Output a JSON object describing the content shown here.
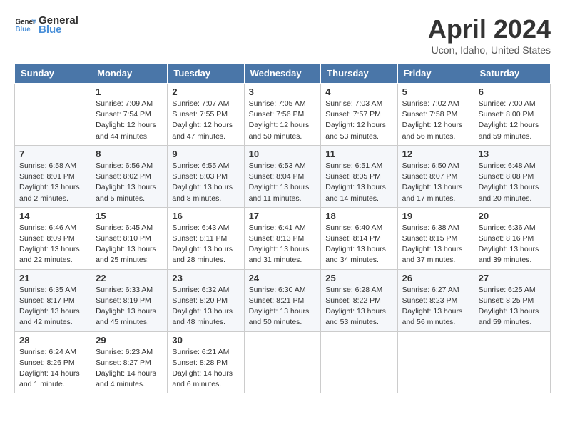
{
  "header": {
    "logo_general": "General",
    "logo_blue": "Blue",
    "month": "April 2024",
    "location": "Ucon, Idaho, United States"
  },
  "weekdays": [
    "Sunday",
    "Monday",
    "Tuesday",
    "Wednesday",
    "Thursday",
    "Friday",
    "Saturday"
  ],
  "weeks": [
    [
      {
        "day": "",
        "info": ""
      },
      {
        "day": "1",
        "info": "Sunrise: 7:09 AM\nSunset: 7:54 PM\nDaylight: 12 hours\nand 44 minutes."
      },
      {
        "day": "2",
        "info": "Sunrise: 7:07 AM\nSunset: 7:55 PM\nDaylight: 12 hours\nand 47 minutes."
      },
      {
        "day": "3",
        "info": "Sunrise: 7:05 AM\nSunset: 7:56 PM\nDaylight: 12 hours\nand 50 minutes."
      },
      {
        "day": "4",
        "info": "Sunrise: 7:03 AM\nSunset: 7:57 PM\nDaylight: 12 hours\nand 53 minutes."
      },
      {
        "day": "5",
        "info": "Sunrise: 7:02 AM\nSunset: 7:58 PM\nDaylight: 12 hours\nand 56 minutes."
      },
      {
        "day": "6",
        "info": "Sunrise: 7:00 AM\nSunset: 8:00 PM\nDaylight: 12 hours\nand 59 minutes."
      }
    ],
    [
      {
        "day": "7",
        "info": "Sunrise: 6:58 AM\nSunset: 8:01 PM\nDaylight: 13 hours\nand 2 minutes."
      },
      {
        "day": "8",
        "info": "Sunrise: 6:56 AM\nSunset: 8:02 PM\nDaylight: 13 hours\nand 5 minutes."
      },
      {
        "day": "9",
        "info": "Sunrise: 6:55 AM\nSunset: 8:03 PM\nDaylight: 13 hours\nand 8 minutes."
      },
      {
        "day": "10",
        "info": "Sunrise: 6:53 AM\nSunset: 8:04 PM\nDaylight: 13 hours\nand 11 minutes."
      },
      {
        "day": "11",
        "info": "Sunrise: 6:51 AM\nSunset: 8:05 PM\nDaylight: 13 hours\nand 14 minutes."
      },
      {
        "day": "12",
        "info": "Sunrise: 6:50 AM\nSunset: 8:07 PM\nDaylight: 13 hours\nand 17 minutes."
      },
      {
        "day": "13",
        "info": "Sunrise: 6:48 AM\nSunset: 8:08 PM\nDaylight: 13 hours\nand 20 minutes."
      }
    ],
    [
      {
        "day": "14",
        "info": "Sunrise: 6:46 AM\nSunset: 8:09 PM\nDaylight: 13 hours\nand 22 minutes."
      },
      {
        "day": "15",
        "info": "Sunrise: 6:45 AM\nSunset: 8:10 PM\nDaylight: 13 hours\nand 25 minutes."
      },
      {
        "day": "16",
        "info": "Sunrise: 6:43 AM\nSunset: 8:11 PM\nDaylight: 13 hours\nand 28 minutes."
      },
      {
        "day": "17",
        "info": "Sunrise: 6:41 AM\nSunset: 8:13 PM\nDaylight: 13 hours\nand 31 minutes."
      },
      {
        "day": "18",
        "info": "Sunrise: 6:40 AM\nSunset: 8:14 PM\nDaylight: 13 hours\nand 34 minutes."
      },
      {
        "day": "19",
        "info": "Sunrise: 6:38 AM\nSunset: 8:15 PM\nDaylight: 13 hours\nand 37 minutes."
      },
      {
        "day": "20",
        "info": "Sunrise: 6:36 AM\nSunset: 8:16 PM\nDaylight: 13 hours\nand 39 minutes."
      }
    ],
    [
      {
        "day": "21",
        "info": "Sunrise: 6:35 AM\nSunset: 8:17 PM\nDaylight: 13 hours\nand 42 minutes."
      },
      {
        "day": "22",
        "info": "Sunrise: 6:33 AM\nSunset: 8:19 PM\nDaylight: 13 hours\nand 45 minutes."
      },
      {
        "day": "23",
        "info": "Sunrise: 6:32 AM\nSunset: 8:20 PM\nDaylight: 13 hours\nand 48 minutes."
      },
      {
        "day": "24",
        "info": "Sunrise: 6:30 AM\nSunset: 8:21 PM\nDaylight: 13 hours\nand 50 minutes."
      },
      {
        "day": "25",
        "info": "Sunrise: 6:28 AM\nSunset: 8:22 PM\nDaylight: 13 hours\nand 53 minutes."
      },
      {
        "day": "26",
        "info": "Sunrise: 6:27 AM\nSunset: 8:23 PM\nDaylight: 13 hours\nand 56 minutes."
      },
      {
        "day": "27",
        "info": "Sunrise: 6:25 AM\nSunset: 8:25 PM\nDaylight: 13 hours\nand 59 minutes."
      }
    ],
    [
      {
        "day": "28",
        "info": "Sunrise: 6:24 AM\nSunset: 8:26 PM\nDaylight: 14 hours\nand 1 minute."
      },
      {
        "day": "29",
        "info": "Sunrise: 6:23 AM\nSunset: 8:27 PM\nDaylight: 14 hours\nand 4 minutes."
      },
      {
        "day": "30",
        "info": "Sunrise: 6:21 AM\nSunset: 8:28 PM\nDaylight: 14 hours\nand 6 minutes."
      },
      {
        "day": "",
        "info": ""
      },
      {
        "day": "",
        "info": ""
      },
      {
        "day": "",
        "info": ""
      },
      {
        "day": "",
        "info": ""
      }
    ]
  ]
}
